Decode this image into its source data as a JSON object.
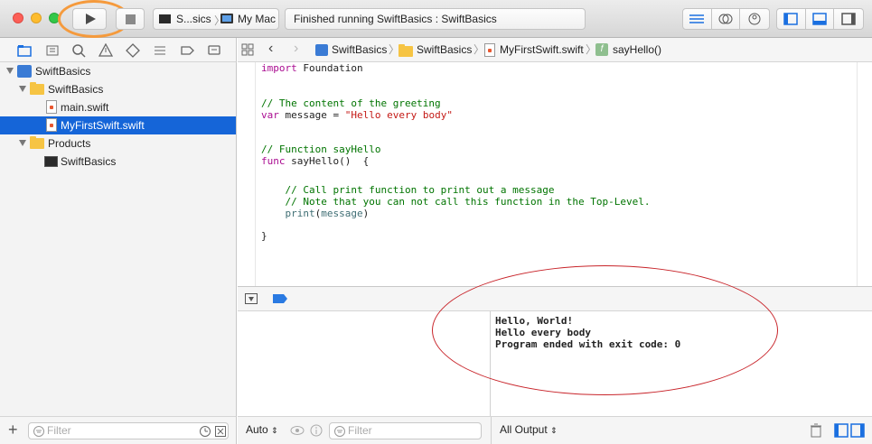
{
  "toolbar": {
    "scheme_target": "S...sics",
    "scheme_device": "My Mac",
    "activity_status": "Finished running SwiftBasics : SwiftBasics",
    "run_icon": "play-icon",
    "stop_icon": "stop-icon"
  },
  "navigator": {
    "tree": [
      {
        "label": "SwiftBasics",
        "icon": "blueprint-icon"
      },
      {
        "label": "SwiftBasics",
        "icon": "folder-icon"
      },
      {
        "label": "main.swift",
        "icon": "swift-file-icon"
      },
      {
        "label": "MyFirstSwift.swift",
        "icon": "swift-file-icon",
        "selected": true
      },
      {
        "label": "Products",
        "icon": "folder-icon"
      },
      {
        "label": "SwiftBasics",
        "icon": "executable-icon"
      }
    ],
    "filter_placeholder": "Filter"
  },
  "jumpbar": {
    "crumbs": [
      "SwiftBasics",
      "SwiftBasics",
      "MyFirstSwift.swift",
      "sayHello()"
    ]
  },
  "editor": {
    "lines": [
      {
        "tokens": [
          {
            "t": "import",
            "c": "kw"
          },
          {
            "t": " Foundation",
            "c": ""
          }
        ]
      },
      {
        "tokens": [
          {
            "t": "// The content of the greeting",
            "c": "cm"
          }
        ]
      },
      {
        "tokens": [
          {
            "t": "var",
            "c": "kw"
          },
          {
            "t": " message = ",
            "c": ""
          },
          {
            "t": "\"Hello every body\"",
            "c": "str"
          }
        ]
      },
      {
        "tokens": [
          {
            "t": "// Function sayHello",
            "c": "cm"
          }
        ]
      },
      {
        "tokens": [
          {
            "t": "func",
            "c": "kw"
          },
          {
            "t": " sayHello()  {",
            "c": ""
          }
        ]
      },
      {
        "tokens": [
          {
            "t": "    // Call print function to print out a message",
            "c": "cm"
          }
        ]
      },
      {
        "tokens": [
          {
            "t": "    // Note that you can not call this function in the Top-Level.",
            "c": "cm"
          }
        ]
      },
      {
        "tokens": [
          {
            "t": "    ",
            "c": ""
          },
          {
            "t": "print",
            "c": "fn"
          },
          {
            "t": "(",
            "c": ""
          },
          {
            "t": "message",
            "c": "fn"
          },
          {
            "t": ")",
            "c": ""
          }
        ]
      },
      {
        "tokens": [
          {
            "t": "}",
            "c": ""
          }
        ]
      }
    ]
  },
  "debug": {
    "variables_scope": "Auto",
    "variables_filter_placeholder": "Filter",
    "console_output_mode": "All Output",
    "console_lines": [
      "Hello, World!",
      "Hello every body",
      "Program ended with exit code: 0"
    ]
  },
  "colors": {
    "selection": "#1565d8",
    "keyword": "#aa0d91",
    "comment": "#007400",
    "string": "#c41a16",
    "annotation_orange": "#f59a3c",
    "annotation_red": "#c8242a"
  }
}
